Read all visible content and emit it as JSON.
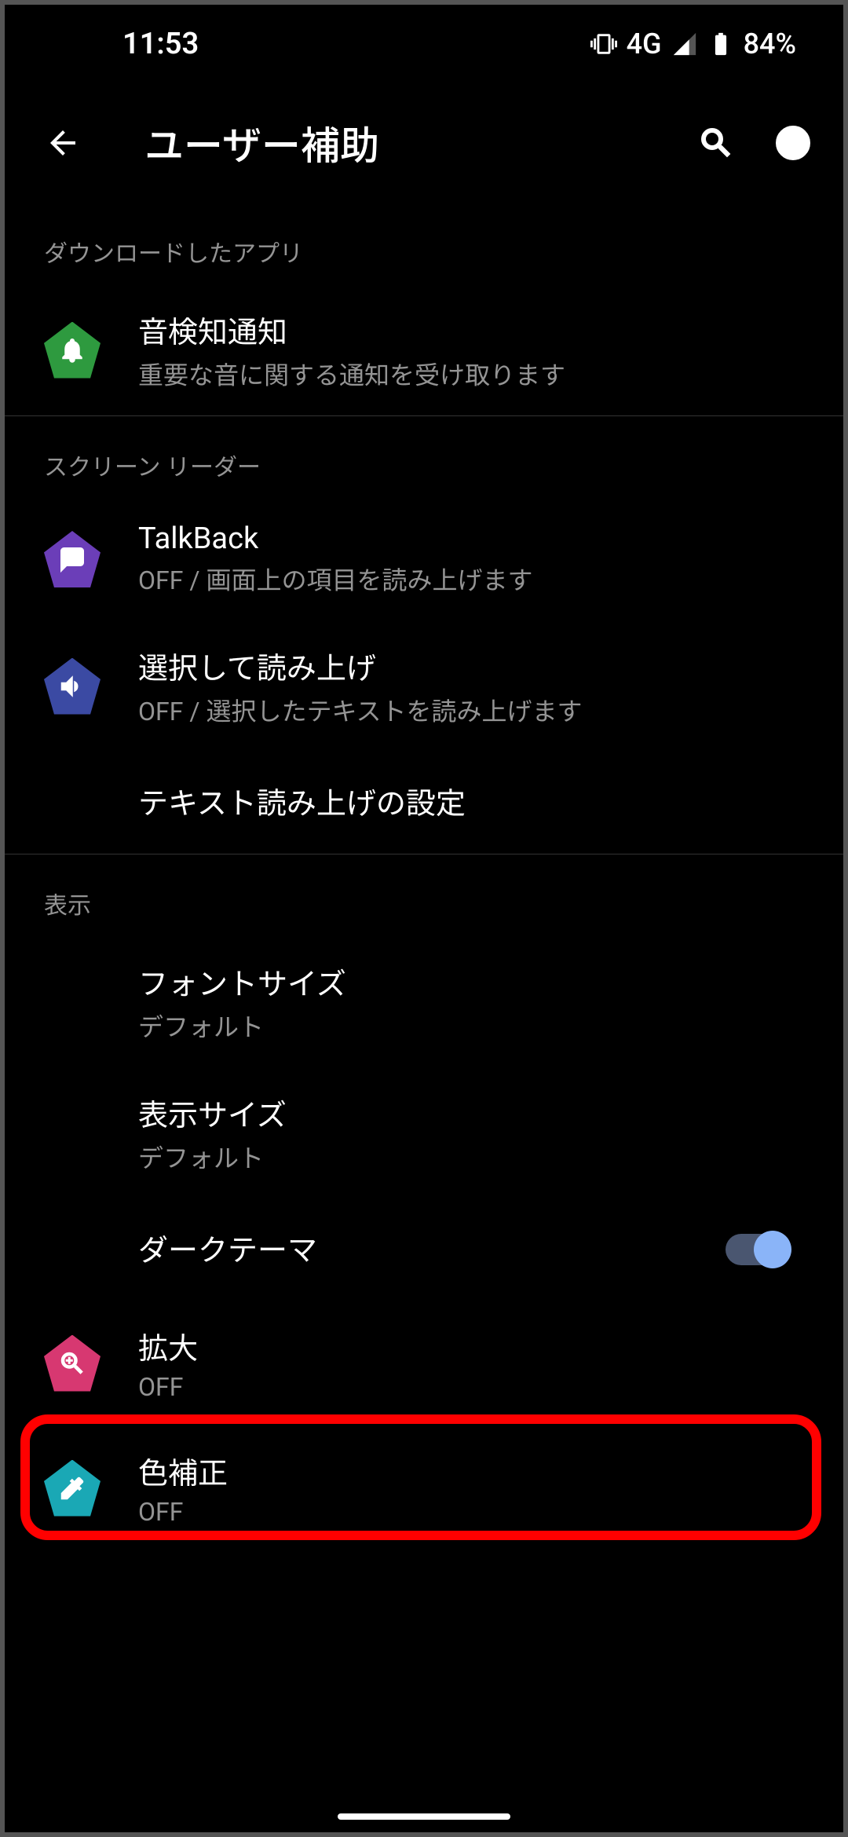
{
  "status": {
    "time": "11:53",
    "network": "4G",
    "battery": "84%"
  },
  "header": {
    "title": "ユーザー補助"
  },
  "sections": {
    "downloaded": {
      "label": "ダウンロードしたアプリ"
    },
    "screenReader": {
      "label": "スクリーン リーダー"
    },
    "display": {
      "label": "表示"
    }
  },
  "items": {
    "soundNotification": {
      "title": "音検知通知",
      "subtitle": "重要な音に関する通知を受け取ります"
    },
    "talkback": {
      "title": "TalkBack",
      "subtitle": "OFF / 画面上の項目を読み上げます"
    },
    "selectToSpeak": {
      "title": "選択して読み上げ",
      "subtitle": "OFF / 選択したテキストを読み上げます"
    },
    "ttsSettings": {
      "title": "テキスト読み上げの設定"
    },
    "fontSize": {
      "title": "フォントサイズ",
      "subtitle": "デフォルト"
    },
    "displaySize": {
      "title": "表示サイズ",
      "subtitle": "デフォルト"
    },
    "darkTheme": {
      "title": "ダークテーマ",
      "enabled": true
    },
    "magnify": {
      "title": "拡大",
      "subtitle": "OFF"
    },
    "colorCorrection": {
      "title": "色補正",
      "subtitle": "OFF"
    }
  }
}
